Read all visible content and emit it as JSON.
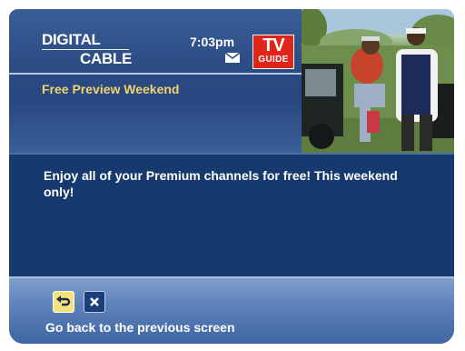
{
  "header": {
    "brand_line1": "DIGITAL",
    "brand_line2": "CABLE",
    "time": "7:03pm",
    "logo_line1": "TV",
    "logo_line2": "GUIDE",
    "page_title": "Free Preview Weekend"
  },
  "message": {
    "text": "Enjoy all of your Premium channels for free! This weekend only!"
  },
  "footer": {
    "back_icon": "back-arrow-icon",
    "close_icon": "close-icon",
    "hint": "Go back to the previous screen"
  },
  "colors": {
    "title_accent": "#f2d36b",
    "logo_red": "#e1251b",
    "back_button": "#f6e27a",
    "panel_blue": "#163a6e"
  }
}
